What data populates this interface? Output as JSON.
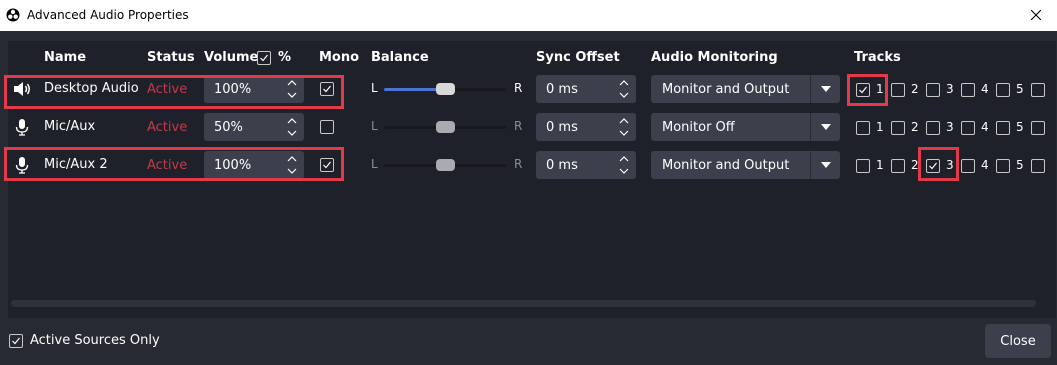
{
  "window": {
    "title": "Advanced Audio Properties",
    "app_icon": "obs-logo-icon",
    "close_icon": "close-icon"
  },
  "headers": {
    "name": "Name",
    "status": "Status",
    "volume": "Volume",
    "volume_percent": "%",
    "volume_percent_checked": true,
    "mono": "Mono",
    "balance": "Balance",
    "sync": "Sync Offset",
    "monitoring": "Audio Monitoring",
    "tracks": "Tracks"
  },
  "balance_labels": {
    "left": "L",
    "right": "R"
  },
  "rows": [
    {
      "icon": "speaker-icon",
      "name": "Desktop Audio",
      "status": "Active",
      "volume": "100%",
      "mono": true,
      "balance": 0.5,
      "sync": "0 ms",
      "monitoring": "Monitor and Output",
      "tracks": [
        {
          "label": "1",
          "checked": true
        },
        {
          "label": "2",
          "checked": false
        },
        {
          "label": "3",
          "checked": false
        },
        {
          "label": "4",
          "checked": false
        },
        {
          "label": "5",
          "checked": false
        }
      ]
    },
    {
      "icon": "microphone-icon",
      "name": "Mic/Aux",
      "status": "Active",
      "volume": "50%",
      "mono": false,
      "balance": 0.5,
      "sync": "0 ms",
      "monitoring": "Monitor Off",
      "tracks": [
        {
          "label": "1",
          "checked": false
        },
        {
          "label": "2",
          "checked": false
        },
        {
          "label": "3",
          "checked": false
        },
        {
          "label": "4",
          "checked": false
        },
        {
          "label": "5",
          "checked": false
        }
      ]
    },
    {
      "icon": "microphone-icon",
      "name": "Mic/Aux 2",
      "status": "Active",
      "volume": "100%",
      "mono": true,
      "balance": 0.5,
      "sync": "0 ms",
      "monitoring": "Monitor and Output",
      "tracks": [
        {
          "label": "1",
          "checked": false
        },
        {
          "label": "2",
          "checked": false
        },
        {
          "label": "3",
          "checked": true
        },
        {
          "label": "4",
          "checked": false
        },
        {
          "label": "5",
          "checked": false
        }
      ]
    }
  ],
  "footer": {
    "active_only_label": "Active Sources Only",
    "active_only_checked": true,
    "close_label": "Close"
  },
  "colors": {
    "status_active": "#c23a48",
    "highlight": "#e23a48",
    "balance_fill": "#4a74d6"
  }
}
